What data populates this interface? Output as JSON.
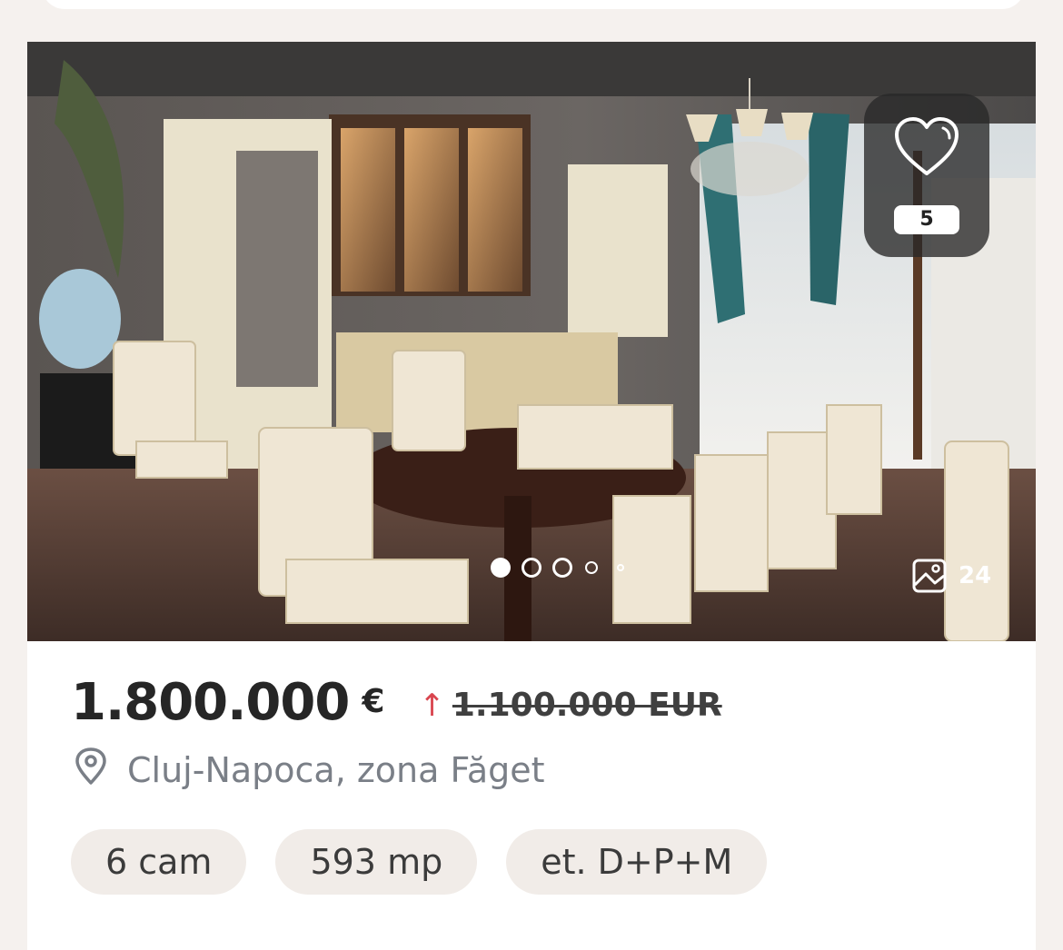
{
  "listing": {
    "favorites_count": "5",
    "photo_count": "24",
    "carousel": {
      "active_index": 0,
      "visible_dots": 5
    },
    "price": "1.800.000",
    "currency_symbol": "€",
    "price_change_icon": "arrow-up-icon",
    "old_price": "1.100.000 EUR",
    "location": "Cluj-Napoca, zona Făget",
    "features": [
      "6 cam",
      "593 mp",
      "et. D+P+M"
    ]
  },
  "colors": {
    "accent_red": "#d9454f",
    "chip_background": "#f1ece8",
    "page_background": "#f5f1ee",
    "muted_text": "#7a7f87"
  },
  "icons": {
    "favorite": "heart-icon",
    "location": "map-pin-icon",
    "photos": "image-icon"
  }
}
